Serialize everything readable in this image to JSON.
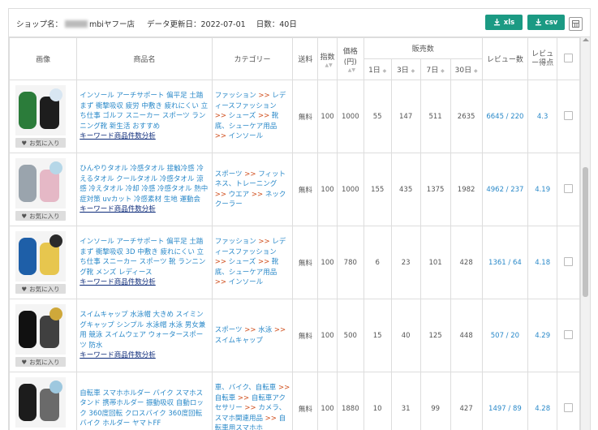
{
  "header": {
    "shop_label": "ショップ名：",
    "shop_name_suffix": "mbiヤフー店",
    "updated_label": "データ更新日：2022-07-01",
    "days_label": "日数：40日",
    "xls_label": "xls",
    "csv_label": "csv"
  },
  "columns": {
    "image": "画像",
    "name": "商品名",
    "category": "カテゴリー",
    "shipping": "送料",
    "index": "指数",
    "price": "価格(円)",
    "sales": "販売数",
    "d1": "1日",
    "d3": "3日",
    "d7": "7日",
    "d30": "30日",
    "reviews": "レビュー数",
    "review_score": "レビュー得点"
  },
  "colors": {
    "accent": "#1b9a83",
    "link": "#2a89c9",
    "category_arrow": "#d04e1c"
  },
  "rows": [
    {
      "name": "インソール アーチサポート 偏平足 土踏まず 衝撃吸収 疲労 中敷き 疲れにくい 立ち仕事 ゴルフ スニーカー スポーツ ランニング靴 新生活 おすすめ",
      "keyword_link": "キーワード商品件数分析",
      "category": [
        "ファッション",
        "レディースファッション",
        "シューズ",
        "靴底、シューケア用品",
        "インソール"
      ],
      "fav": "お気に入り",
      "shipping": "無料",
      "index": "100",
      "price": "1000",
      "d1": "55",
      "d3": "147",
      "d7": "511",
      "d30": "2635",
      "reviews": "6645 / 220",
      "score": "4.3"
    },
    {
      "name": "ひんやりタオル 冷感タオル 接触冷感 冷えるタオル クールタオル 冷感タオル 涼感 冷えタオル 冷却 冷感 冷感タオル 熱中症対策 uvカット 冷感素材 生地 運動会",
      "keyword_link": "キーワード商品件数分析",
      "category": [
        "スポーツ",
        "フィットネス、トレーニング",
        "ウエア",
        "ネッククーラー"
      ],
      "fav": "お気に入り",
      "shipping": "無料",
      "index": "100",
      "price": "1000",
      "d1": "155",
      "d3": "435",
      "d7": "1375",
      "d30": "1982",
      "reviews": "4962 / 237",
      "score": "4.19"
    },
    {
      "name": "インソール アーチサポート 偏平足 土踏まず 衝撃吸収 3D 中敷き 疲れにくい 立ち仕事 スニーカー スポーツ 靴 ランニング靴 メンズ レディース",
      "keyword_link": "キーワード商品件数分析",
      "category": [
        "ファッション",
        "レディースファッション",
        "シューズ",
        "靴底、シューケア用品",
        "インソール"
      ],
      "fav": "お気に入り",
      "shipping": "無料",
      "index": "100",
      "price": "780",
      "d1": "6",
      "d3": "23",
      "d7": "101",
      "d30": "428",
      "reviews": "1361 / 64",
      "score": "4.18"
    },
    {
      "name": "スイムキャップ 水泳帽 大きめ スイミングキャップ シンプル 水泳帽 水泳 男女兼用 競泳 スイムウェア ウォータースポーツ 防水",
      "keyword_link": "キーワード商品件数分析",
      "category": [
        "スポーツ",
        "水泳",
        "スイムキャップ"
      ],
      "fav": "お気に入り",
      "shipping": "無料",
      "index": "100",
      "price": "500",
      "d1": "15",
      "d3": "40",
      "d7": "125",
      "d30": "448",
      "reviews": "507 / 20",
      "score": "4.29"
    },
    {
      "name": "自転車 スマホホルダー バイク スマホスタンド 携帯ホルダー 振動吸収 自動ロック 360度回転 クロスバイク 360度回転 バイク ホルダー ヤマトFF",
      "keyword_link": "",
      "category": [
        "車、バイク、自転車",
        "自転車",
        "自転車アクセサリー",
        "カメラ、スマホ関連用品",
        "自転車用スマホホ"
      ],
      "fav": "お気に入り",
      "shipping": "無料",
      "index": "100",
      "price": "1880",
      "d1": "10",
      "d3": "31",
      "d7": "99",
      "d30": "427",
      "reviews": "1497 / 89",
      "score": "4.28"
    }
  ]
}
